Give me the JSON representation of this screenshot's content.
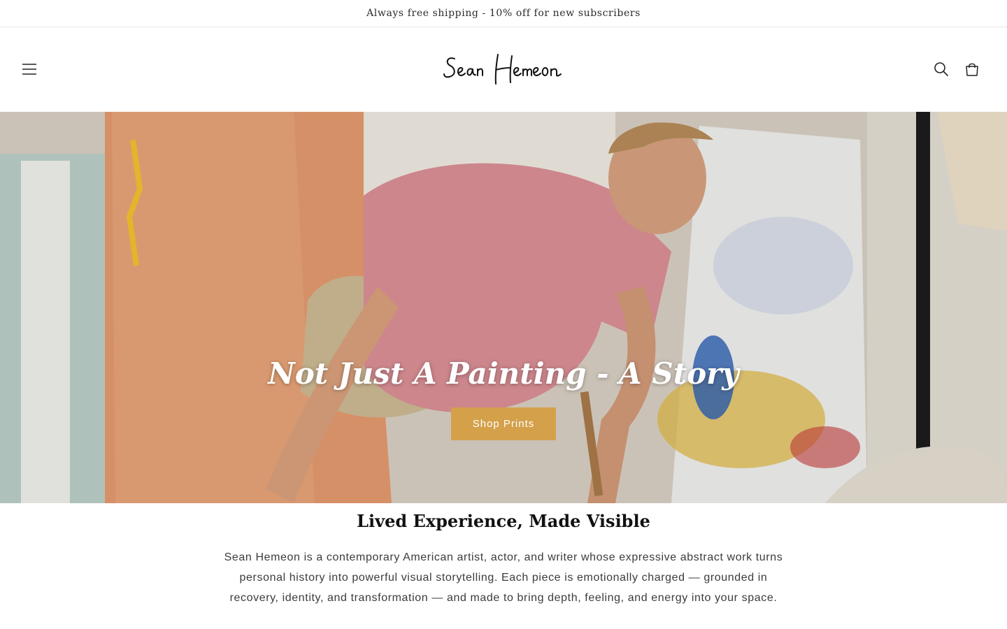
{
  "announcement": {
    "text": "Always free shipping - 10% off for new subscribers"
  },
  "header": {
    "logo_text": "Sean Hemeon",
    "menu_icon": "hamburger-menu-icon",
    "search_icon": "search-icon",
    "cart_icon": "cart-icon"
  },
  "hero": {
    "title": "Not Just A Painting - A Story",
    "button_label": "Shop Prints",
    "button_color": "#d4a04a"
  },
  "intro": {
    "title": "Lived Experience, Made Visible",
    "body": "Sean Hemeon is a contemporary American artist, actor, and writer whose expressive abstract work turns personal history into powerful visual storytelling. Each piece is emotionally charged — grounded in recovery, identity, and transformation — and made to bring depth, feeling, and energy into your space."
  }
}
